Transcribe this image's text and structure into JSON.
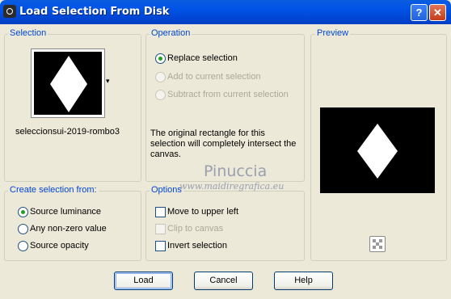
{
  "window": {
    "title": "Load Selection From Disk",
    "help_label": "?",
    "close_label": "✕"
  },
  "selection_group": {
    "label": "Selection",
    "filename": "seleccionsui-2019-rombo3",
    "dropdown_arrow": "▾"
  },
  "operation_group": {
    "label": "Operation",
    "options": [
      {
        "label": "Replace selection",
        "checked": true,
        "enabled": true
      },
      {
        "label": "Add to current selection",
        "checked": false,
        "enabled": false
      },
      {
        "label": "Subtract from current selection",
        "checked": false,
        "enabled": false
      }
    ],
    "description": "The original rectangle for this selection will completely intersect the canvas."
  },
  "preview_group": {
    "label": "Preview",
    "transparency_icon": "checkerboard-icon"
  },
  "create_from_group": {
    "label": "Create selection from:",
    "options": [
      {
        "label": "Source luminance",
        "checked": true
      },
      {
        "label": "Any non-zero value",
        "checked": false
      },
      {
        "label": "Source opacity",
        "checked": false
      }
    ]
  },
  "options_group": {
    "label": "Options",
    "items": [
      {
        "label": "Move to upper left",
        "checked": false,
        "enabled": true
      },
      {
        "label": "Clip to canvas",
        "checked": false,
        "enabled": false
      },
      {
        "label": "Invert selection",
        "checked": false,
        "enabled": true
      }
    ]
  },
  "watermark": {
    "name": "Pinuccia",
    "url": "www.maidiregrafica.eu"
  },
  "buttons": {
    "load": "Load",
    "cancel": "Cancel",
    "help": "Help"
  },
  "colors": {
    "titlebar": "#0053e6",
    "group_label": "#0046d5",
    "dialog_bg": "#ece9d8"
  }
}
